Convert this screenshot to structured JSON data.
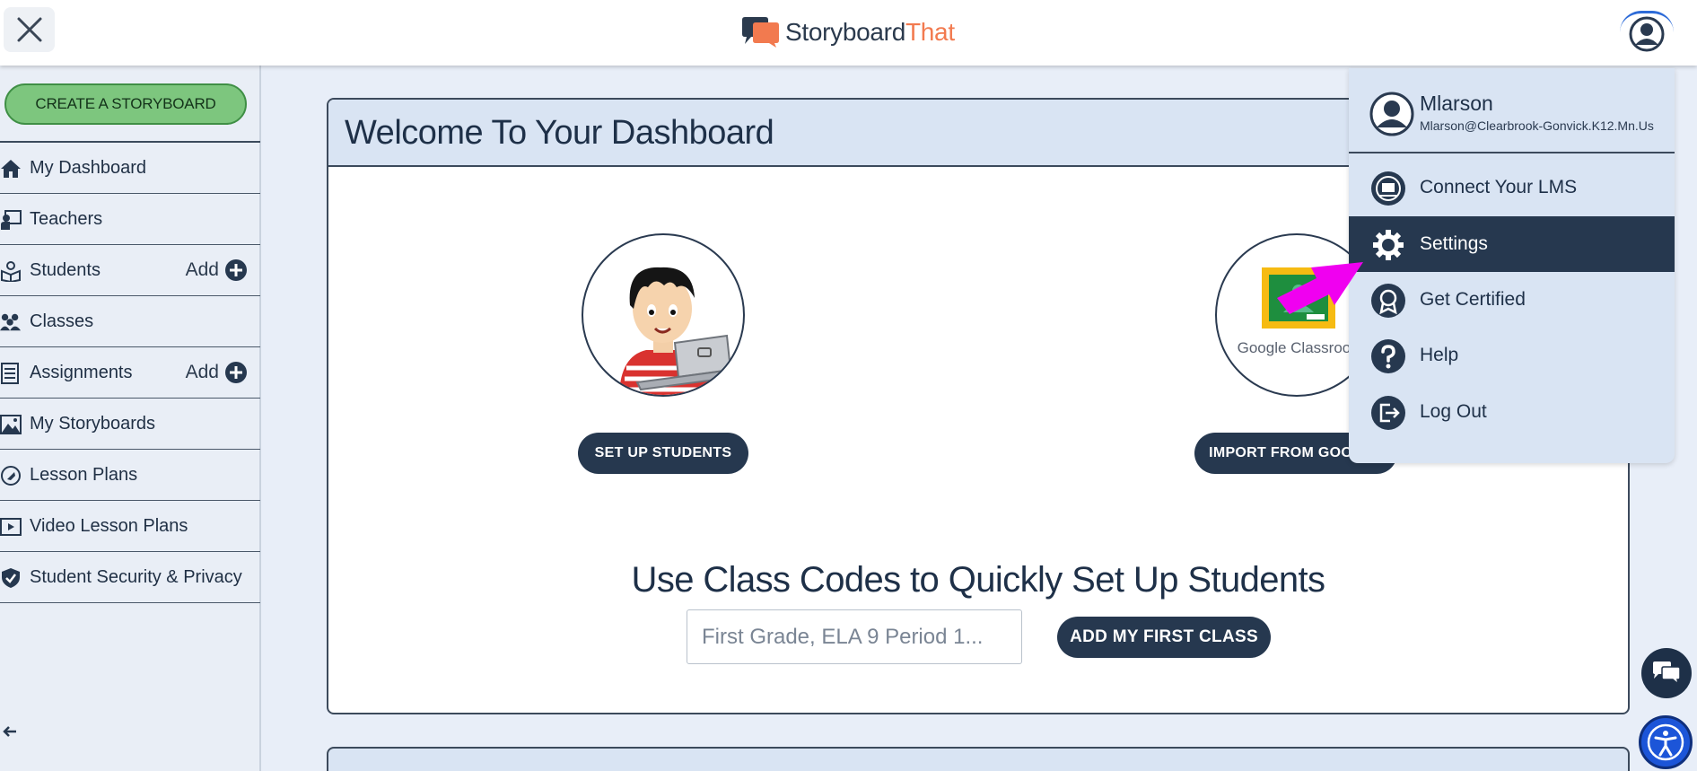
{
  "topbar": {
    "logo_main": "Storyboard",
    "logo_accent": "That"
  },
  "sidebar": {
    "create_label": "CREATE A STORYBOARD",
    "items": [
      {
        "label": "My Dashboard",
        "icon": "home-icon"
      },
      {
        "label": "Teachers",
        "icon": "teacher-icon"
      },
      {
        "label": "Students",
        "icon": "student-icon",
        "add": "Add"
      },
      {
        "label": "Classes",
        "icon": "classes-icon"
      },
      {
        "label": "Assignments",
        "icon": "assignments-icon",
        "add": "Add"
      },
      {
        "label": "My Storyboards",
        "icon": "image-icon"
      },
      {
        "label": "Lesson Plans",
        "icon": "lesson-plans-icon"
      },
      {
        "label": "Video Lesson Plans",
        "icon": "video-icon"
      },
      {
        "label": "Student Security & Privacy",
        "icon": "shield-icon"
      }
    ]
  },
  "main": {
    "title": "Welcome To Your Dashboard",
    "setup_button": "SET UP STUDENTS",
    "google_label": "Google Classroom",
    "import_button": "IMPORT FROM GOOGLE",
    "codes_title": "Use Class Codes to Quickly Set Up Students",
    "class_input_placeholder": "First Grade, ELA 9 Period 1...",
    "add_class_button": "ADD MY FIRST CLASS"
  },
  "menu": {
    "user_name": "Mlarson",
    "user_email": "Mlarson@Clearbrook-Gonvick.K12.Mn.Us",
    "items": [
      {
        "label": "Connect Your LMS",
        "icon": "lms-icon"
      },
      {
        "label": "Settings",
        "icon": "gear-icon",
        "active": true
      },
      {
        "label": "Get Certified",
        "icon": "certificate-icon"
      },
      {
        "label": "Help",
        "icon": "help-icon"
      },
      {
        "label": "Log Out",
        "icon": "logout-icon"
      }
    ]
  },
  "colors": {
    "navy": "#26384f",
    "create_green": "#7dc67e",
    "menu_bg": "#d9e4f3",
    "highlight_arrow": "#f000f0",
    "logo_accent": "#f27a4f"
  }
}
